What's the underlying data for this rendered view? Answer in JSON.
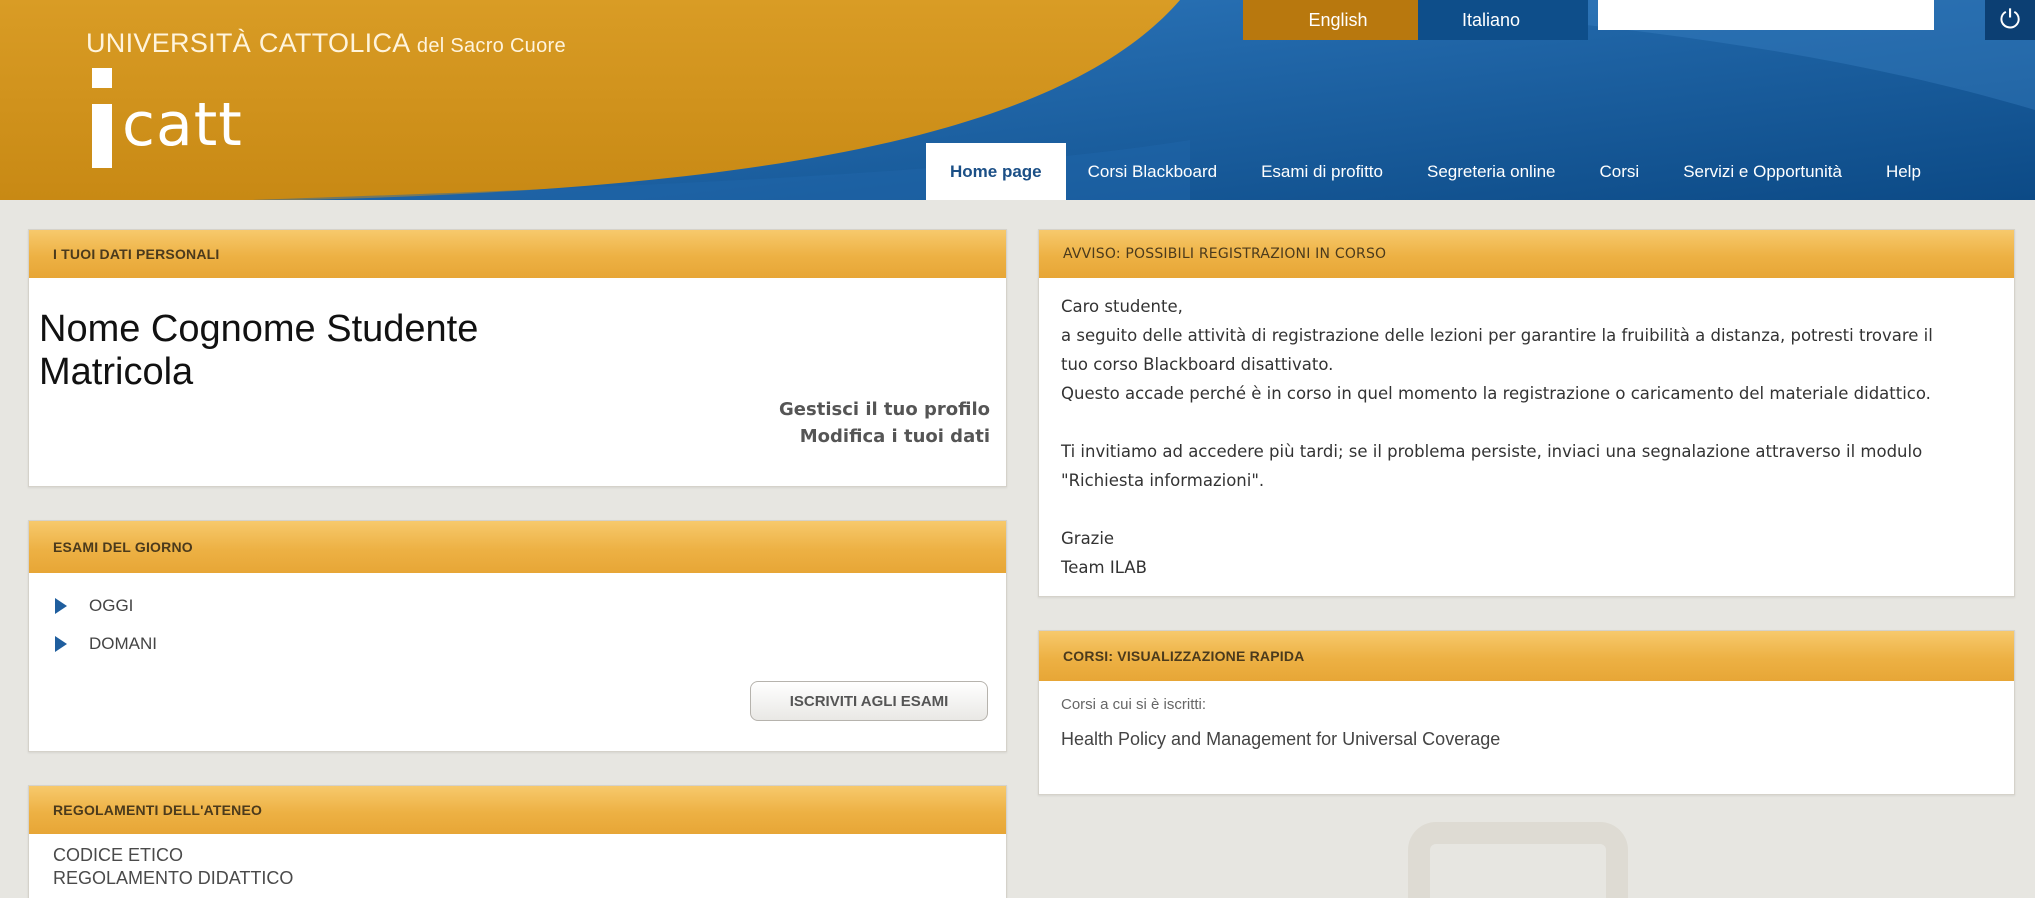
{
  "header": {
    "university": "UNIVERSITÀ CATTOLICA",
    "university_suffix": "del Sacro Cuore",
    "logo_text": "catt",
    "lang_en": "English",
    "lang_it": "Italiano",
    "search_value": "",
    "power_icon": "power-icon"
  },
  "nav": {
    "items": [
      {
        "label": "Home page"
      },
      {
        "label": "Corsi Blackboard"
      },
      {
        "label": "Esami di profitto"
      },
      {
        "label": "Segreteria online"
      },
      {
        "label": "Corsi"
      },
      {
        "label": "Servizi e Opportunità"
      },
      {
        "label": "Help"
      }
    ]
  },
  "personal": {
    "title": "I TUOI DATI PERSONALI",
    "name": "Nome Cognome Studente",
    "matricola": "Matricola",
    "manage_profile": "Gestisci il tuo profilo",
    "edit_data": "Modifica i tuoi dati"
  },
  "exams": {
    "title": "ESAMI DEL GIORNO",
    "items": [
      {
        "label": "OGGI"
      },
      {
        "label": "DOMANI"
      }
    ],
    "enroll_button": "ISCRIVITI AGLI ESAMI"
  },
  "regulations": {
    "title": "REGOLAMENTI DELL'ATENEO",
    "links": [
      {
        "label": "CODICE ETICO"
      },
      {
        "label": "REGOLAMENTO DIDATTICO"
      }
    ]
  },
  "notice": {
    "title": "AVVISO: POSSIBILI REGISTRAZIONI IN CORSO",
    "greeting": "Caro studente,",
    "line1": "a seguito delle attività di registrazione delle lezioni per garantire la fruibilità a distanza, potresti trovare il",
    "line2": "tuo corso Blackboard disattivato.",
    "line3": "Questo accade perché è in corso in quel momento la registrazione o caricamento del materiale didattico.",
    "line4": "Ti invitiamo ad accedere più tardi; se il problema persiste, inviaci una segnalazione attraverso il modulo",
    "line5": "\"Richiesta informazioni\".",
    "thanks": "Grazie",
    "signature": "Team ILAB"
  },
  "courses": {
    "title": "CORSI: VISUALIZZAZIONE RAPIDA",
    "label": "Corsi a cui si è iscritti:",
    "items": [
      {
        "label": "Health Policy and Management for Universal Coverage"
      }
    ]
  },
  "colors": {
    "gold": "#e7a636",
    "blue": "#1b5d9e",
    "background": "#e7e6e1"
  }
}
